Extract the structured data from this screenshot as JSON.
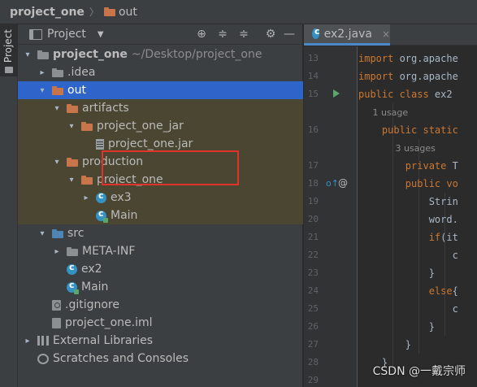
{
  "breadcrumb": {
    "project": "project_one",
    "folder": "out"
  },
  "left_strip": {
    "tab_label": "Project"
  },
  "panel": {
    "title": "Project",
    "caret": "▼",
    "tools": [
      "⊕",
      "≑",
      "≑",
      "⚙",
      "—"
    ]
  },
  "tree": [
    {
      "label": "project_one",
      "sub": "~/Desktop/project_one",
      "arrow": "▾",
      "icon": "folder-gray-icon"
    },
    {
      "label": ".idea",
      "arrow": "▸",
      "icon": "folder-gray-icon"
    },
    {
      "label": "out",
      "arrow": "▾",
      "icon": "folder-orange-icon",
      "state": "selected"
    },
    {
      "label": "artifacts",
      "arrow": "▾",
      "icon": "folder-orange-icon",
      "state": "highlight"
    },
    {
      "label": "project_one_jar",
      "arrow": "▾",
      "icon": "folder-orange-icon",
      "state": "highlight"
    },
    {
      "label": "project_one.jar",
      "arrow": "",
      "icon": "jar-icon",
      "state": "highlight"
    },
    {
      "label": "production",
      "arrow": "▾",
      "icon": "folder-orange-icon",
      "state": "highlight"
    },
    {
      "label": "project_one",
      "arrow": "▾",
      "icon": "folder-orange-icon",
      "state": "highlight"
    },
    {
      "label": "ex3",
      "arrow": "▸",
      "icon": "class-icon",
      "state": "highlight"
    },
    {
      "label": "Main",
      "arrow": "",
      "icon": "class-run-icon",
      "state": "highlight"
    },
    {
      "label": "src",
      "arrow": "▾",
      "icon": "folder-blue-icon"
    },
    {
      "label": "META-INF",
      "arrow": "▸",
      "icon": "folder-gray-icon"
    },
    {
      "label": "ex2",
      "arrow": "",
      "icon": "class-icon"
    },
    {
      "label": "Main",
      "arrow": "",
      "icon": "class-run-icon"
    },
    {
      "label": ".gitignore",
      "arrow": "",
      "icon": "gitignore-file-icon"
    },
    {
      "label": "project_one.iml",
      "arrow": "",
      "icon": "iml-file-icon"
    },
    {
      "label": "External Libraries",
      "arrow": "▸",
      "icon": "library-icon"
    },
    {
      "label": "Scratches and Consoles",
      "arrow": "",
      "icon": "scratches-icon"
    }
  ],
  "editor": {
    "tab": {
      "label": "ex2.java",
      "close": "×"
    },
    "lines": [
      {
        "num": "13",
        "segments": [
          {
            "k": "kw",
            "t": "import "
          },
          {
            "k": "",
            "t": "org.apache"
          }
        ]
      },
      {
        "num": "14",
        "segments": [
          {
            "k": "kw",
            "t": "import "
          },
          {
            "k": "",
            "t": "org.apache"
          }
        ]
      },
      {
        "num": "15",
        "segments": [
          {
            "k": "kw",
            "t": "public class "
          },
          {
            "k": "",
            "t": "ex2 "
          }
        ]
      },
      {
        "num": "",
        "segments": [
          {
            "k": "hint",
            "t": "     1 usage"
          }
        ]
      },
      {
        "num": "16",
        "segments": [
          {
            "k": "",
            "t": "    "
          },
          {
            "k": "kw",
            "t": "public static"
          }
        ]
      },
      {
        "num": "",
        "segments": [
          {
            "k": "hint",
            "t": "             3 usages"
          }
        ]
      },
      {
        "num": "17",
        "segments": [
          {
            "k": "",
            "t": "        "
          },
          {
            "k": "kw",
            "t": "private "
          },
          {
            "k": "",
            "t": "T"
          }
        ]
      },
      {
        "num": "18",
        "segments": [
          {
            "k": "",
            "t": "        "
          },
          {
            "k": "kw",
            "t": "public vo"
          }
        ]
      },
      {
        "num": "19",
        "segments": [
          {
            "k": "",
            "t": "            Strin"
          }
        ]
      },
      {
        "num": "20",
        "segments": [
          {
            "k": "",
            "t": "            word."
          }
        ]
      },
      {
        "num": "21",
        "segments": [
          {
            "k": "",
            "t": "            "
          },
          {
            "k": "kw",
            "t": "if"
          },
          {
            "k": "",
            "t": "(it"
          }
        ]
      },
      {
        "num": "22",
        "segments": [
          {
            "k": "",
            "t": "                c"
          }
        ]
      },
      {
        "num": "23",
        "segments": [
          {
            "k": "",
            "t": "            }"
          }
        ]
      },
      {
        "num": "24",
        "segments": [
          {
            "k": "",
            "t": "            "
          },
          {
            "k": "kw",
            "t": "else"
          },
          {
            "k": "",
            "t": "{"
          }
        ]
      },
      {
        "num": "25",
        "segments": [
          {
            "k": "",
            "t": "                c"
          }
        ]
      },
      {
        "num": "26",
        "segments": [
          {
            "k": "",
            "t": "            }"
          }
        ]
      },
      {
        "num": "27",
        "segments": [
          {
            "k": "",
            "t": "        }"
          }
        ]
      },
      {
        "num": "28",
        "segments": [
          {
            "k": "",
            "t": "    }"
          }
        ]
      },
      {
        "num": "29",
        "segments": [
          {
            "k": "",
            "t": ""
          }
        ]
      }
    ]
  },
  "watermark": "CSDN @一戴宗师"
}
